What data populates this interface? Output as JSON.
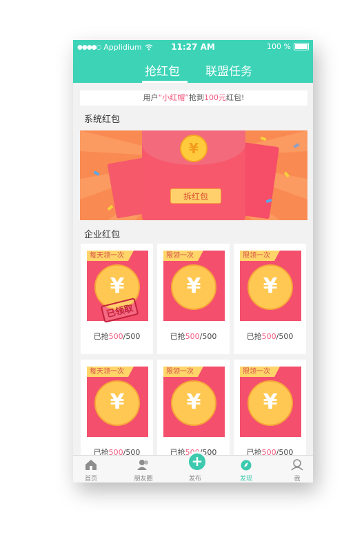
{
  "status_bar": {
    "carrier": "Applidium",
    "time": "11:27 AM",
    "battery": "100 %"
  },
  "tabs": [
    {
      "label": "抢红包",
      "active": true
    },
    {
      "label": "联盟任务",
      "active": false
    }
  ],
  "announcement": {
    "prefix": "用户",
    "user": "“小红帽”",
    "middle": "抢到",
    "amount": "100元",
    "suffix": "红包!"
  },
  "sections": {
    "system": "系统红包",
    "enterprise": "企业红包"
  },
  "banner": {
    "button_label": "拆红包",
    "coin_symbol": "¥"
  },
  "cards": [
    {
      "tag": "每天领一次",
      "grabbed": "500",
      "total": "/500",
      "prefix": "已抢",
      "stamp": "已领取"
    },
    {
      "tag": "限领一次",
      "grabbed": "500",
      "total": "/500",
      "prefix": "已抢"
    },
    {
      "tag": "限领一次",
      "grabbed": "500",
      "total": "/500",
      "prefix": "已抢"
    },
    {
      "tag": "每天领一次",
      "grabbed": "500",
      "total": "/500",
      "prefix": "已抢"
    },
    {
      "tag": "限领一次",
      "grabbed": "500",
      "total": "/500",
      "prefix": "已抢"
    },
    {
      "tag": "限领一次",
      "grabbed": "500",
      "total": "/500",
      "prefix": "已抢"
    }
  ],
  "coin_symbol": "¥",
  "bottom_nav": [
    {
      "label": "首页",
      "icon": "home-icon"
    },
    {
      "label": "朋友圈",
      "icon": "friends-icon"
    },
    {
      "label": "发布",
      "icon": "plus-icon"
    },
    {
      "label": "发现",
      "icon": "discover-icon",
      "active": true
    },
    {
      "label": "我",
      "icon": "profile-icon"
    }
  ],
  "colors": {
    "accent": "#3cd3b7",
    "red_packet": "#f44f6d",
    "highlight": "#f2597e",
    "coin": "#ffc852"
  }
}
